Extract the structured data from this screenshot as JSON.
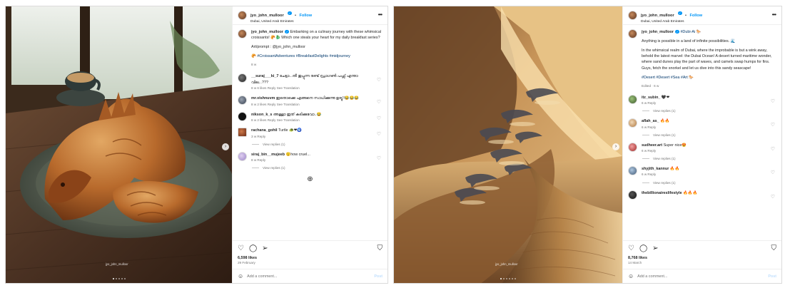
{
  "post1": {
    "username": "jyo_john_mulloor",
    "follow_label": "Follow",
    "location": "Dubai, United Arab Emirates",
    "watermark": "jyo_john_mulloor",
    "caption": {
      "username": "jyo_john_mulloor",
      "text": "Embarking on a culinary journey with these whimsical croissants! 🥐🐉 Which one steals your heart for my daily breakfast series?",
      "credit": "Art/prompt : @jyo_john_mulloor",
      "hashtags": "🥐 #CroissantAdventures #BreakfastDelights #midjourney",
      "time": "8 w"
    },
    "comments": [
      {
        "user": "__suraj___ki_7",
        "text": "ചേട്ടാ...തീ തുപ്പുന്ന രണ്ട് ഡ്രാഗൺ പഫ്സ് എന്താ വില...???",
        "meta": "8 w   6 likes   Reply   See Translation",
        "avatar": "av-a"
      },
      {
        "user": "mr.vishnuvm",
        "text": "ഇതൊക്കെ എങ്ങനെ സാധിക്കുന്നു ഉദ്യു!!😂😂😂",
        "meta": "8 w   2 likes   Reply   See Translation",
        "avatar": "av-c"
      },
      {
        "user": "nikson_k_s",
        "text": "അള്ളാ ഇത് കടിക്കുവോ..😂",
        "meta": "8 w   2 likes   Reply   See Translation",
        "avatar": "av-d"
      },
      {
        "user": "rachana_gohil",
        "text": "Turtle 🐢❤🧿",
        "meta": "3 w   Reply",
        "avatar": "av-e",
        "replies": "View replies (1)"
      },
      {
        "user": "siraj_bin__mujeeb",
        "text": "😟how cruel...",
        "meta": "8 w   Reply",
        "avatar": "av-f",
        "replies": "View replies (1)"
      }
    ],
    "likes": "6,598 likes",
    "date": "29 February",
    "add_comment_placeholder": "Add a comment...",
    "post_label": "Post"
  },
  "post2": {
    "username": "jyo_john_mulloor",
    "follow_label": "Follow",
    "location": "Dubai, United Arab Emirates",
    "watermark": "jyo_john_mulloor",
    "caption": {
      "username": "jyo_john_mulloor",
      "tag": "#Dubi-Ai 🐎",
      "line1": "Anything is possible in a land of infinite possibilities. 🌊",
      "body": "In the whimsical realm of Dubai, where the improbable is but a wink away, behold the latest marvel: the Dubai Ocean! A desert turned maritime wonder, where sand dunes play the part of waves, and camels swap humps for fins. Guys, fetch the snorkel and let us dive into this sandy seascape!",
      "hashtags": "#Desert #Desert #Sea #Art 🐎",
      "time": "Edited · 6 w"
    },
    "comments": [
      {
        "user": "itz_subin_",
        "text": "🖤❤",
        "meta": "6 w   Reply",
        "avatar": "av-g",
        "replies": "View replies (1)"
      },
      {
        "user": "aflah_as_",
        "text": "🔥🔥",
        "meta": "6 w   Reply",
        "avatar": "av-h",
        "replies": "View replies (1)"
      },
      {
        "user": "sudheer.art",
        "text": "Super nice😍",
        "meta": "6 w   Reply",
        "avatar": "av-i",
        "replies": "View replies (1)"
      },
      {
        "user": "shyjith_kannur",
        "text": "🔥🔥",
        "meta": "6 w   Reply",
        "avatar": "av-j",
        "replies": "View replies (1)"
      },
      {
        "user": "thebillionaireslifestyle",
        "text": "🔥🔥🔥",
        "meta": "",
        "avatar": "av-k"
      }
    ],
    "likes": "8,768 likes",
    "date": "14 March",
    "add_comment_placeholder": "Add a comment...",
    "post_label": "Post"
  },
  "icons": {
    "heart": "heart-icon",
    "comment": "comment-icon",
    "share": "share-icon",
    "save": "bookmark-icon",
    "more": "more-options-icon",
    "emoji": "emoji-icon",
    "next": "chevron-right-icon",
    "load_more": "plus-circle-icon"
  }
}
